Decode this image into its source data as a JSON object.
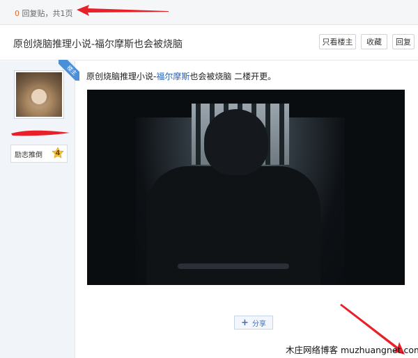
{
  "topbar": {
    "reply_count": "0",
    "reply_text": "回复贴，共1页"
  },
  "thread": {
    "title": "原创烧脑推理小说-福尔摩斯也会被烧脑",
    "buttons": {
      "owner_only": "只看楼主",
      "favorite": "收藏",
      "reply": "回复"
    }
  },
  "author": {
    "owner_badge": "楼主",
    "tag_label": "励志推倒",
    "level": "4"
  },
  "post": {
    "text_prefix": "原创烧脑推理小说-",
    "text_link": "福尔摩斯",
    "text_suffix": "也会被烧脑 二楼开更。"
  },
  "share": {
    "label": "分享"
  },
  "watermark": "木庄网络博客 muzhuangnet.com",
  "colors": {
    "accent_blue": "#4b8fd8",
    "reply_count": "#e06c2b",
    "annotation_red": "#e8202a"
  }
}
